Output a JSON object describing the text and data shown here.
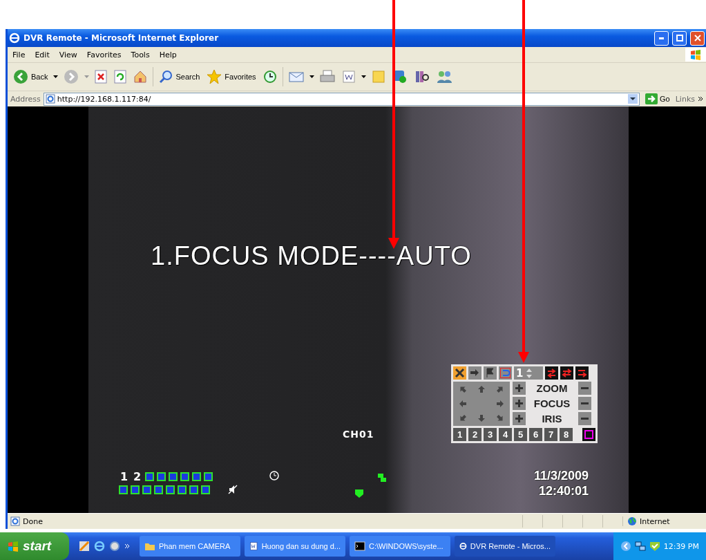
{
  "window": {
    "title": "DVR Remote - Microsoft Internet Explorer"
  },
  "menu": [
    "File",
    "Edit",
    "View",
    "Favorites",
    "Tools",
    "Help"
  ],
  "toolbar": {
    "back": "Back",
    "search": "Search",
    "favorites": "Favorites"
  },
  "address": {
    "label": "Address",
    "value": "http://192.168.1.117:84/",
    "go": "Go",
    "links": "Links"
  },
  "osd": {
    "menu_line": "1.FOCUS MODE----AUTO",
    "channel": "CH01",
    "date": "11/3/2009",
    "time": "12:40:01",
    "channel_digits": [
      "1",
      "2"
    ]
  },
  "ptz": {
    "preset": "1",
    "labels": [
      "ZOOM",
      "FOCUS",
      "IRIS"
    ],
    "channels": [
      "1",
      "2",
      "3",
      "4",
      "5",
      "6",
      "7",
      "8"
    ]
  },
  "status_bar": {
    "text": "Done",
    "zone": "Internet"
  },
  "taskbar": {
    "start": "start",
    "tasks": [
      {
        "label": "Phan mem CAMERA",
        "kind": "folder",
        "selected": false
      },
      {
        "label": "Huong dan su dung d...",
        "kind": "word",
        "selected": false
      },
      {
        "label": "C:\\WINDOWS\\syste...",
        "kind": "console",
        "selected": false
      },
      {
        "label": "DVR Remote - Micros...",
        "kind": "browser",
        "selected": true
      }
    ],
    "clock": "12:39 PM"
  }
}
